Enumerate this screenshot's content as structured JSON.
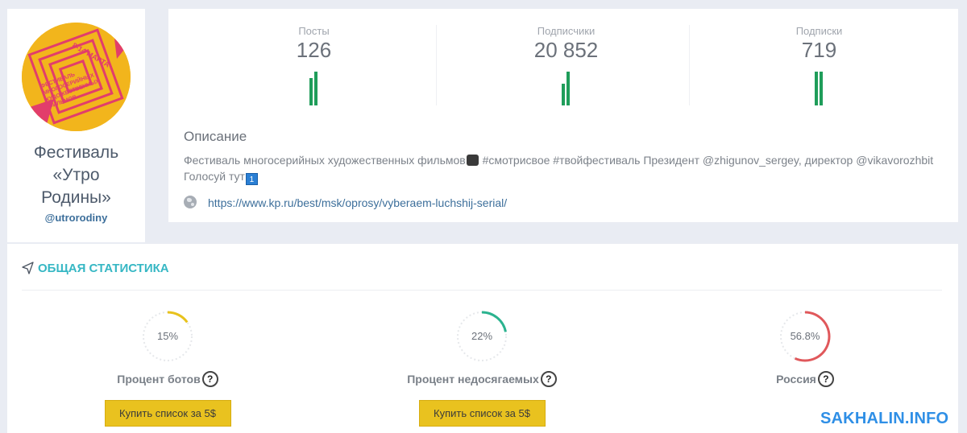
{
  "profile": {
    "avatar_icon": "festival-logo-image",
    "avatar_text": "8-14 МАРТА ФЕСТИВАЛЬ МНОГОСЕРИЙНЫХ ХУДОЖЕСТВЕННЫХ ФИЛЬМОВ",
    "name": "Фестиваль «Утро Родины»",
    "handle": "@utrorodiny"
  },
  "stats": [
    {
      "label": "Посты",
      "value": "126",
      "bars": [
        0.8,
        1.0
      ]
    },
    {
      "label": "Подписчики",
      "value": "20 852",
      "bars": [
        0.65,
        1.0
      ]
    },
    {
      "label": "Подписки",
      "value": "719",
      "bars": [
        1.0,
        1.0
      ]
    }
  ],
  "description": {
    "title": "Описание",
    "text_part1": "Фестиваль многосерийных художественных фильмов",
    "text_part2": " #смотрисвое #твойфестиваль Президент @zhigunov_sergey, директор @vikavorozhbit",
    "text_part3": "Голосуй тут",
    "key_icon_label": "1",
    "link_icon": "globe-icon",
    "link": "https://www.kp.ru/best/msk/oprosy/vyberaem-luchshij-serial/"
  },
  "general": {
    "icon": "send-icon",
    "title": "ОБЩАЯ СТАТИСТИКА",
    "metrics": [
      {
        "value_text": "15%",
        "percent": 15,
        "color": "#e8c21c",
        "label": "Процент ботов",
        "help": "?",
        "button": "Купить список за 5$"
      },
      {
        "value_text": "22%",
        "percent": 22,
        "color": "#2bb38f",
        "label": "Процент недосягаемых",
        "help": "?",
        "button": "Купить список за 5$"
      },
      {
        "value_text": "56.8%",
        "percent": 56.8,
        "color": "#e0585b",
        "label": "Россия",
        "help": "?"
      }
    ]
  },
  "watermark": "SAKHALIN.INFO"
}
